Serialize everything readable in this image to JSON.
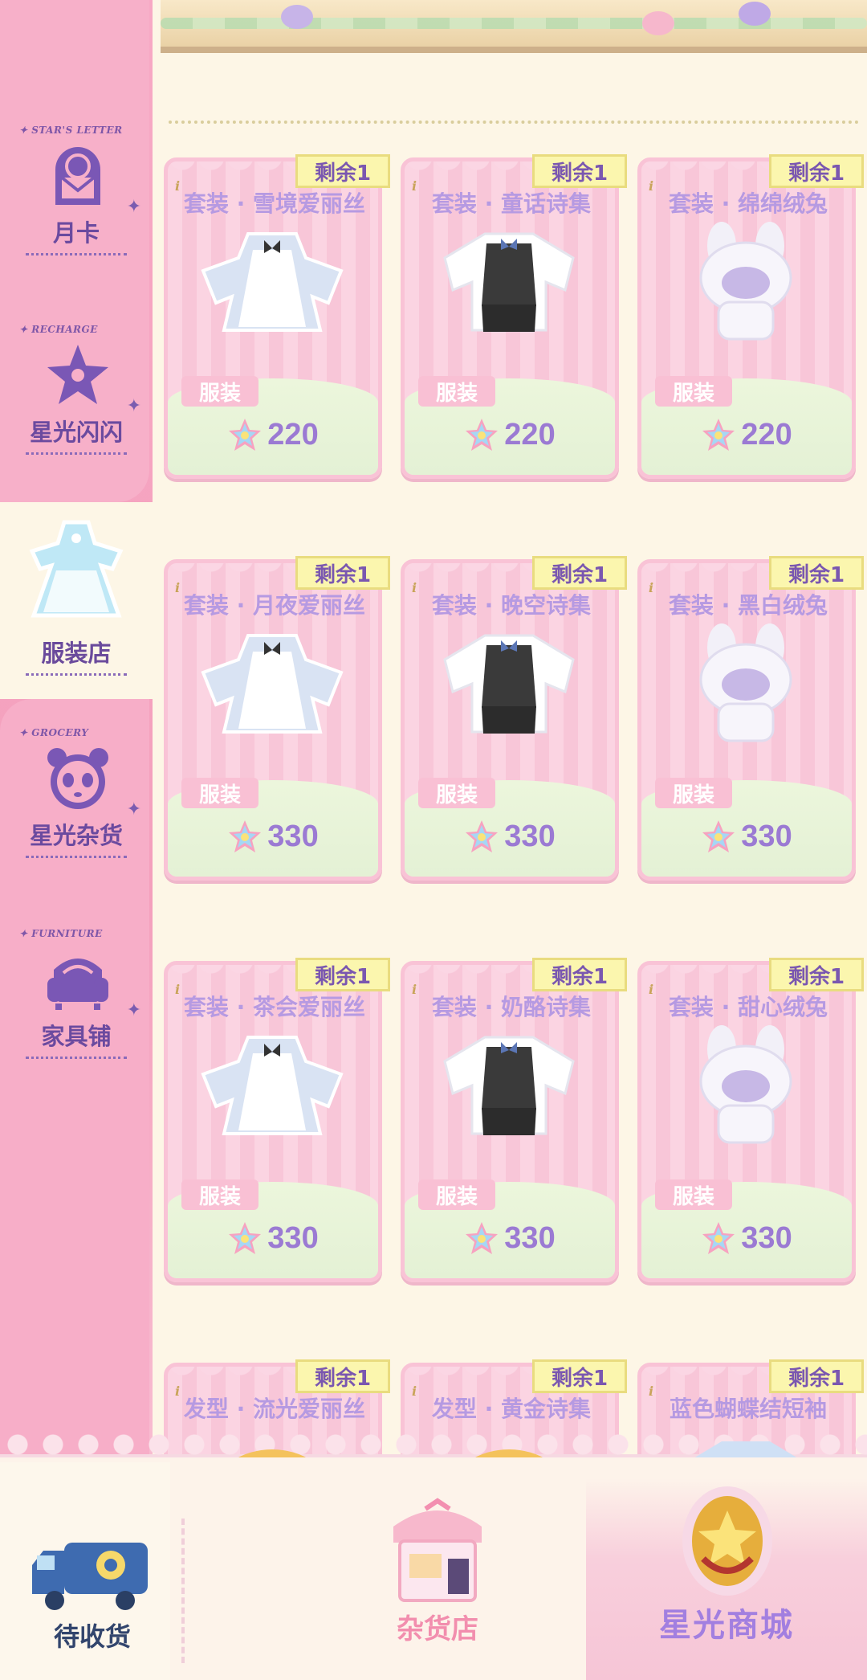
{
  "sidebar": {
    "items": [
      {
        "tag": "STAR'S LETTER",
        "label": "月卡"
      },
      {
        "tag": "RECHARGE",
        "label": "星光闪闪"
      },
      {
        "tag": "",
        "label": "服装店"
      },
      {
        "tag": "GROCERY",
        "label": "星光杂货"
      },
      {
        "tag": "FURNITURE",
        "label": "家具铺"
      }
    ]
  },
  "products": [
    {
      "remain": "剩余1",
      "title": "套装 · 雪境爱丽丝",
      "type": "服装",
      "price": "220",
      "icon": "dress-outfit-icon"
    },
    {
      "remain": "剩余1",
      "title": "套装 · 童话诗集",
      "type": "服装",
      "price": "220",
      "icon": "vest-suit-icon"
    },
    {
      "remain": "剩余1",
      "title": "套装 · 绵绵绒兔",
      "type": "服装",
      "price": "220",
      "icon": "bunny-costume-icon"
    },
    {
      "remain": "剩余1",
      "title": "套装 · 月夜爱丽丝",
      "type": "服装",
      "price": "330",
      "icon": "dress-outfit-icon"
    },
    {
      "remain": "剩余1",
      "title": "套装 · 晚空诗集",
      "type": "服装",
      "price": "330",
      "icon": "vest-suit-icon"
    },
    {
      "remain": "剩余1",
      "title": "套装 · 黑白绒兔",
      "type": "服装",
      "price": "330",
      "icon": "bunny-costume-icon"
    },
    {
      "remain": "剩余1",
      "title": "套装 · 茶会爱丽丝",
      "type": "服装",
      "price": "330",
      "icon": "dress-outfit-icon"
    },
    {
      "remain": "剩余1",
      "title": "套装 · 奶酪诗集",
      "type": "服装",
      "price": "330",
      "icon": "vest-suit-icon"
    },
    {
      "remain": "剩余1",
      "title": "套装 · 甜心绒兔",
      "type": "服装",
      "price": "330",
      "icon": "bunny-costume-icon"
    },
    {
      "remain": "剩余1",
      "title": "发型 · 流光爱丽丝",
      "type": "",
      "price": "",
      "icon": "hair-icon"
    },
    {
      "remain": "剩余1",
      "title": "发型 · 黄金诗集",
      "type": "",
      "price": "",
      "icon": "hair-icon"
    },
    {
      "remain": "剩余1",
      "title": "蓝色蝴蝶结短袖",
      "type": "",
      "price": "",
      "icon": "shirt-icon"
    }
  ],
  "bottom_bar": {
    "pending_label": "待收货",
    "grocery_label": "杂货店",
    "mall_label": "星光商城"
  },
  "colors": {
    "sidebar_pink": "#f7aec8",
    "label_purple": "#6b4a9f",
    "price_purple": "#9b7ad3",
    "remain_yellow": "#fbf6ae",
    "background_cream": "#fdf6e6"
  }
}
